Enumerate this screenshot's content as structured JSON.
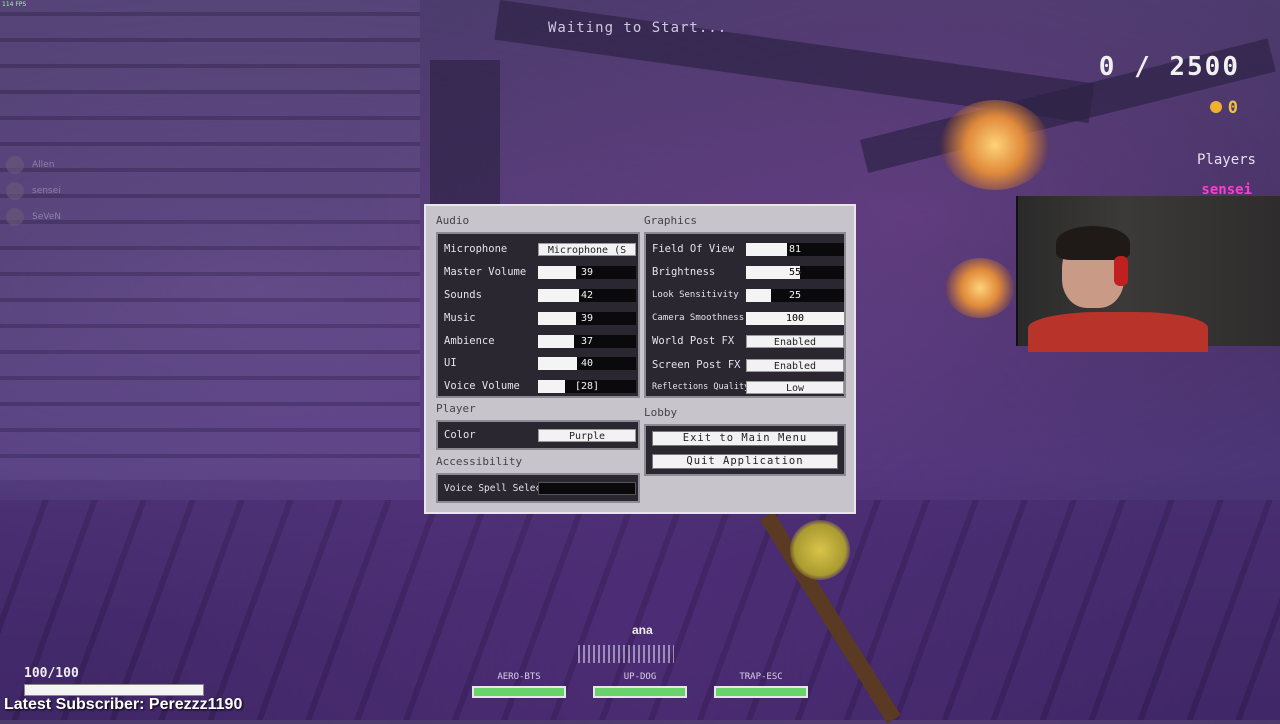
{
  "hud": {
    "fps": "114 FPS",
    "waiting": "Waiting to Start...",
    "score": "0 / 2500",
    "coins": "0",
    "players_title": "Players",
    "player_name": "sensei",
    "speaker": "ana",
    "health": "100/100",
    "health_fraction": 1.0,
    "latest_subscriber": "Latest Subscriber: Perezzz1190",
    "slots": [
      {
        "label": "AERO-BTS"
      },
      {
        "label": "UP-DOG"
      },
      {
        "label": "TRAP-ESC"
      }
    ]
  },
  "chat": [
    {
      "name": "Allen"
    },
    {
      "name": "sensei"
    },
    {
      "name": "SeVeN"
    }
  ],
  "settings": {
    "audio": {
      "title": "Audio",
      "microphone_label": "Microphone",
      "microphone_value": "Microphone (S",
      "sliders": [
        {
          "label": "Master Volume",
          "value": "39",
          "fraction": 0.39
        },
        {
          "label": "Sounds",
          "value": "42",
          "fraction": 0.42
        },
        {
          "label": "Music",
          "value": "39",
          "fraction": 0.39
        },
        {
          "label": "Ambience",
          "value": "37",
          "fraction": 0.37
        },
        {
          "label": "UI",
          "value": "40",
          "fraction": 0.4
        },
        {
          "label": "Voice Volume",
          "value": "[28]",
          "fraction": 0.28
        }
      ]
    },
    "graphics": {
      "title": "Graphics",
      "sliders": [
        {
          "label": "Field Of View",
          "value": "81",
          "fraction": 0.42
        },
        {
          "label": "Brightness",
          "value": "55",
          "fraction": 0.55
        },
        {
          "label": "Look Sensitivity",
          "value": "25",
          "fraction": 0.25
        },
        {
          "label": "Camera Smoothness",
          "value": "100",
          "fraction": 1.0
        }
      ],
      "world_post_fx_label": "World Post FX",
      "world_post_fx_value": "Enabled",
      "screen_post_fx_label": "Screen Post FX",
      "screen_post_fx_value": "Enabled",
      "reflections_label": "Reflections Quality",
      "reflections_value": "Low"
    },
    "player": {
      "title": "Player",
      "color_label": "Color",
      "color_value": "Purple"
    },
    "lobby": {
      "title": "Lobby",
      "exit_label": "Exit to Main Menu",
      "quit_label": "Quit Application"
    },
    "accessibility": {
      "title": "Accessibility",
      "voice_spell_label": "Voice Spell Select"
    }
  }
}
